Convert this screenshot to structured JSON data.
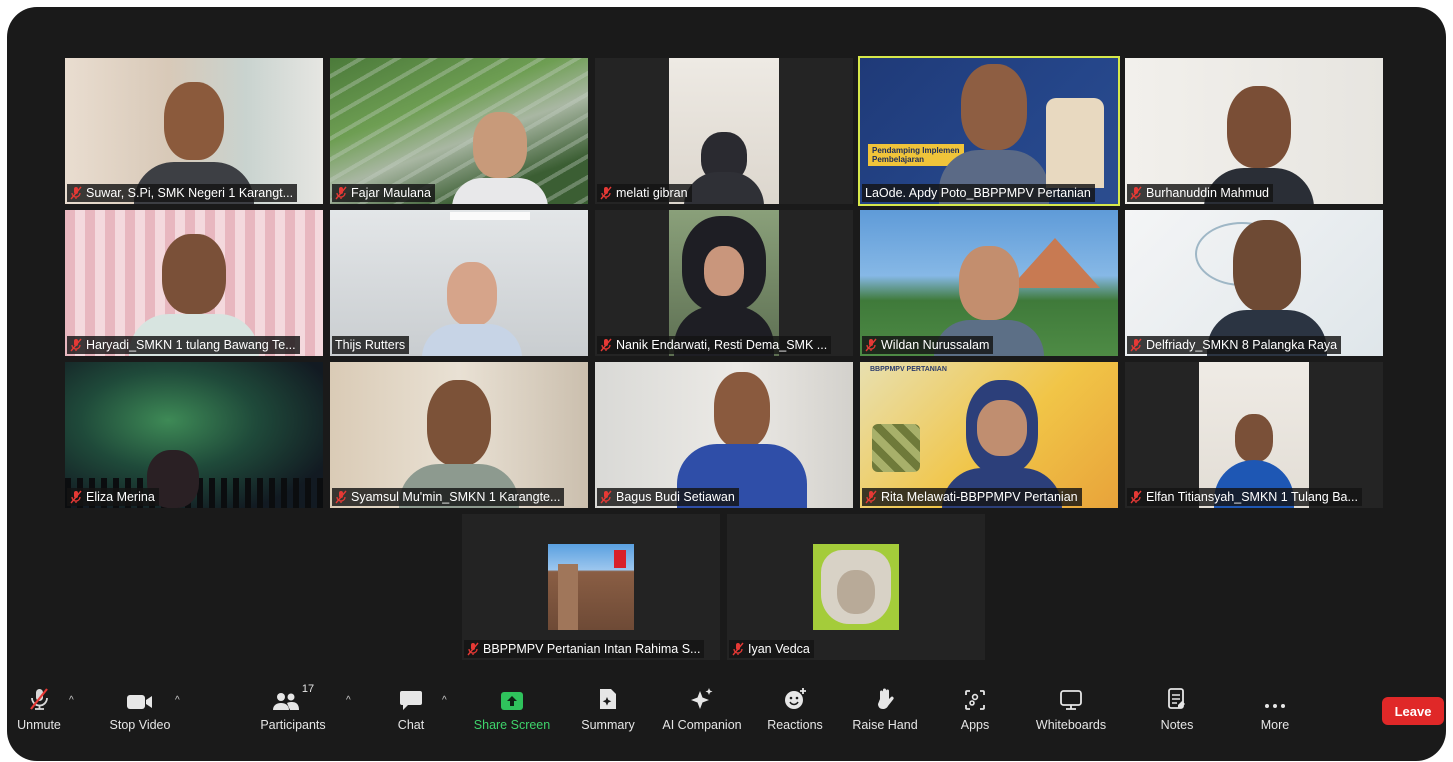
{
  "participants": [
    {
      "name": "Suwar, S.Pi, SMK Negeri 1 Karangt...",
      "muted": true
    },
    {
      "name": "Fajar Maulana",
      "muted": true
    },
    {
      "name": "melati gibran",
      "muted": true
    },
    {
      "name": "LaOde. Apdy Poto_BBPPMPV Pertanian",
      "muted": false,
      "active": true
    },
    {
      "name": "Burhanuddin Mahmud",
      "muted": true
    },
    {
      "name": "Haryadi_SMKN 1 tulang Bawang Te...",
      "muted": true
    },
    {
      "name": "Thijs Rutters",
      "muted": false
    },
    {
      "name": "Nanik Endarwati, Resti Dema_SMK ...",
      "muted": true
    },
    {
      "name": "Wildan Nurussalam",
      "muted": true
    },
    {
      "name": "Delfriady_SMKN 8 Palangka Raya",
      "muted": true
    },
    {
      "name": "Eliza Merina",
      "muted": true
    },
    {
      "name": "Syamsul Mu'min_SMKN 1 Karangte...",
      "muted": true
    },
    {
      "name": "Bagus Budi Setiawan",
      "muted": true
    },
    {
      "name": "Rita Melawati-BBPPMPV Pertanian",
      "muted": true
    },
    {
      "name": "Elfan Titiansyah_SMKN 1 Tulang Ba...",
      "muted": true
    },
    {
      "name": "BBPPMPV Pertanian Intan Rahima S...",
      "muted": true
    },
    {
      "name": "Iyan Vedca",
      "muted": true
    }
  ],
  "slide_texts": {
    "laode_slide_line1": "Pendamping Implemen",
    "laode_slide_line2": "Pembelajaran",
    "rita_banner": "BBPPMPV PERTANIAN"
  },
  "toolbar": {
    "unmute": "Unmute",
    "stop_video": "Stop Video",
    "participants": "Participants",
    "participants_count": "17",
    "chat": "Chat",
    "share_screen": "Share Screen",
    "summary": "Summary",
    "ai_companion": "AI Companion",
    "reactions": "Reactions",
    "raise_hand": "Raise Hand",
    "apps": "Apps",
    "whiteboards": "Whiteboards",
    "notes": "Notes",
    "more": "More",
    "leave": "Leave"
  },
  "colors": {
    "window_bg": "#1a1a1a",
    "active_speaker": "#d7e84a",
    "leave_red": "#e02828",
    "share_green": "#3ed36b",
    "muted_red": "#e53935"
  }
}
